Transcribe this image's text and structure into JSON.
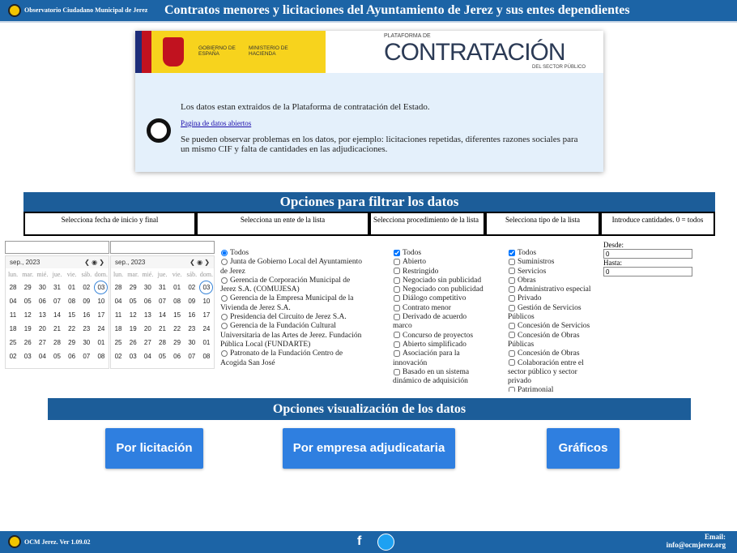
{
  "header": {
    "org": "Observatorio Ciudadano Municipal de Jerez",
    "title": "Contratos menores y licitaciones del Ayuntamiento de Jerez y sus entes dependientes"
  },
  "banner": {
    "gobierno": "GOBIERNO DE ESPAÑA",
    "ministerio": "MINISTERIO DE HACIENDA",
    "plataforma_de": "PLATAFORMA DE",
    "contratacion": "CONTRATACIÓN",
    "sector": "DEL SECTOR PÚBLICO",
    "info1": "Los datos estan extraidos de la Plataforma de contratación del Estado.",
    "link": "Pagina de datos abiertos",
    "info2": "Se pueden observar problemas en los datos, por ejemplo: licitaciones repetidas, diferentes razones sociales para un mismo CIF y falta de cantidades en las adjudicaciones."
  },
  "filter": {
    "title": "Opciones para filtrar los datos",
    "cols": [
      "Selecciona fecha de inicio y final",
      "Selecciona un ente de la lista",
      "Selecciona procedimiento de la lista",
      "Selecciona tipo de la lista",
      "Introduce cantidades. 0 = todos"
    ]
  },
  "calendar": {
    "month": "sep., 2023",
    "weekdays": [
      "lun.",
      "mar.",
      "mié.",
      "jue.",
      "vie.",
      "sáb.",
      "dom."
    ],
    "days": [
      "28",
      "29",
      "30",
      "31",
      "01",
      "02",
      "03",
      "04",
      "05",
      "06",
      "07",
      "08",
      "09",
      "10",
      "11",
      "12",
      "13",
      "14",
      "15",
      "16",
      "17",
      "18",
      "19",
      "20",
      "21",
      "22",
      "23",
      "24",
      "25",
      "26",
      "27",
      "28",
      "29",
      "30",
      "01",
      "02",
      "03",
      "04",
      "05",
      "06",
      "07",
      "08"
    ],
    "selected": "03"
  },
  "entes": [
    {
      "label": "Todos",
      "checked": true
    },
    {
      "label": "Junta de Gobierno Local del Ayuntamiento de Jerez"
    },
    {
      "label": "Gerencia de Corporación Municipal de Jerez S.A. (COMUJESA)"
    },
    {
      "label": "Gerencia de la Empresa Municipal de la Vivienda de Jerez S.A."
    },
    {
      "label": "Presidencia del Circuito de Jerez S.A."
    },
    {
      "label": "Gerencia de la Fundación Cultural Universitaria de las Artes de Jerez. Fundación Pública Local (FUNDARTE)"
    },
    {
      "label": "Patronato de la Fundación Centro de Acogida San José"
    }
  ],
  "procedimientos": [
    {
      "label": "Todos",
      "checked": true
    },
    {
      "label": "Abierto"
    },
    {
      "label": "Restringido"
    },
    {
      "label": "Negociado sin publicidad"
    },
    {
      "label": "Negociado con publicidad"
    },
    {
      "label": "Diálogo competitivo"
    },
    {
      "label": "Contrato menor"
    },
    {
      "label": "Derivado de acuerdo marco"
    },
    {
      "label": "Concurso de proyectos"
    },
    {
      "label": "Abierto simplificado"
    },
    {
      "label": "Asociación para la innovación"
    },
    {
      "label": "Basado en un sistema dinámico de adquisición"
    }
  ],
  "tipos": [
    {
      "label": "Todos",
      "checked": true
    },
    {
      "label": "Suministros"
    },
    {
      "label": "Servicios"
    },
    {
      "label": "Obras"
    },
    {
      "label": "Administrativo especial"
    },
    {
      "label": "Privado"
    },
    {
      "label": "Gestión de Servicios Públicos"
    },
    {
      "label": "Concesión de Servicios"
    },
    {
      "label": "Concesión de Obras Públicas"
    },
    {
      "label": "Concesión de Obras"
    },
    {
      "label": "Colaboración entre el sector público y sector privado"
    },
    {
      "label": "Patrimonial"
    }
  ],
  "amounts": {
    "desde_label": "Desde:",
    "desde": "0",
    "hasta_label": "Hasta:",
    "hasta": "0"
  },
  "viz": {
    "title": "Opciones visualización de los datos",
    "buttons": [
      "Por licitación",
      "Por empresa adjudicataria",
      "Gráficos"
    ]
  },
  "footer": {
    "version": "OCM Jerez. Ver 1.09.02",
    "email_label": "Email:",
    "email": "info@ocmjerez.org"
  }
}
